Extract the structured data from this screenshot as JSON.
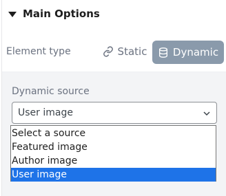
{
  "section": {
    "title": "Main Options",
    "icon": "caret-down-icon"
  },
  "element_type": {
    "label": "Element type",
    "static_label": "Static",
    "dynamic_label": "Dynamic",
    "selected": "Dynamic"
  },
  "dynamic_source": {
    "label": "Dynamic source",
    "value": "User image",
    "options": [
      "Select a source",
      "Featured image",
      "Author image",
      "User image"
    ],
    "selected_index": 3
  },
  "colors": {
    "accent": "#8a9aab",
    "highlight": "#1e73e8"
  }
}
